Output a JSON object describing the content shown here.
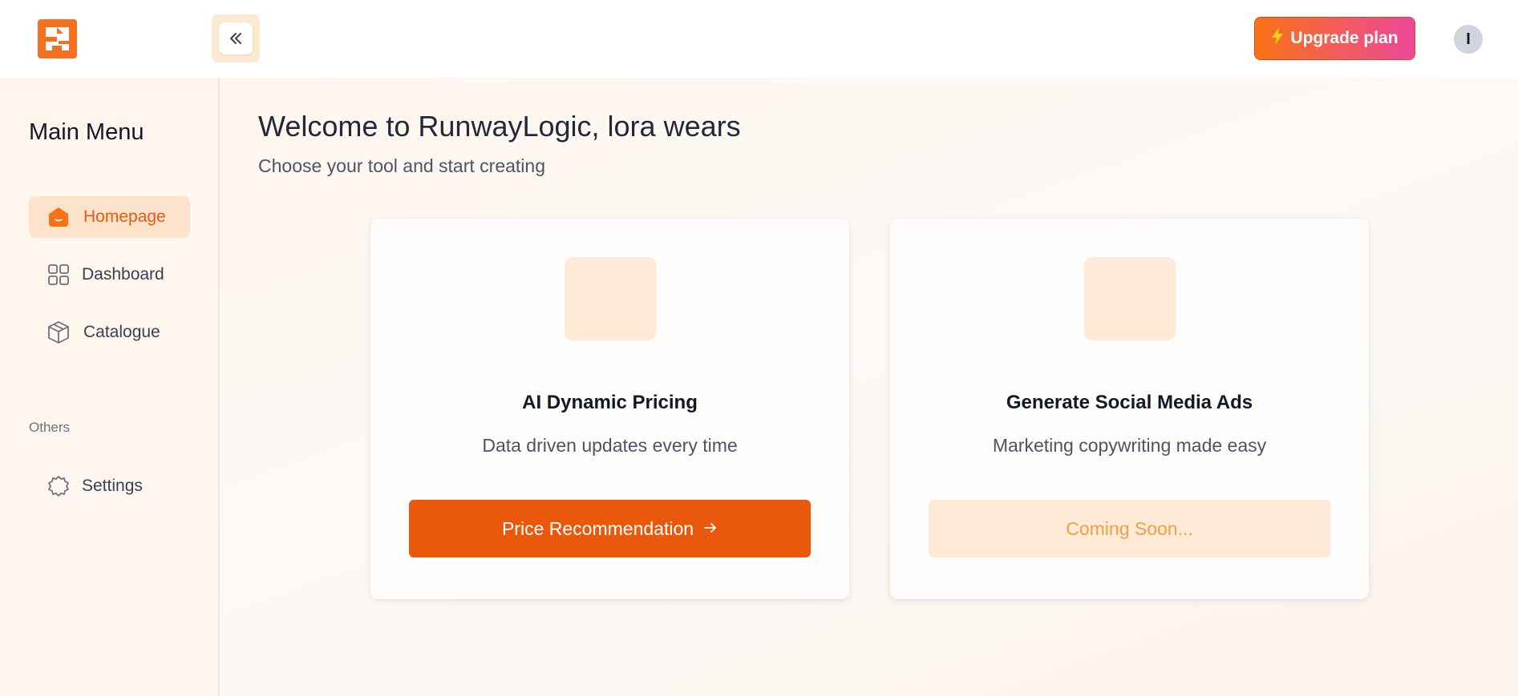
{
  "header": {
    "logo_icon": "brand-logo-icon",
    "collapse_icon": "double-chevron-left-icon",
    "upgrade_label": "Upgrade plan",
    "upgrade_icon": "lightning-icon",
    "avatar_initial": "I"
  },
  "sidebar": {
    "title": "Main Menu",
    "items": [
      {
        "label": "Homepage",
        "icon": "home-icon",
        "active": true
      },
      {
        "label": "Dashboard",
        "icon": "grid-icon",
        "active": false
      },
      {
        "label": "Catalogue",
        "icon": "box-icon",
        "active": false
      }
    ],
    "others_label": "Others",
    "others_items": [
      {
        "label": "Settings",
        "icon": "gear-icon",
        "active": false
      }
    ]
  },
  "main": {
    "welcome": "Welcome to RunwayLogic, lora wears",
    "subtitle": "Choose your tool and start creating",
    "cards": [
      {
        "title": "AI Dynamic Pricing",
        "description": "Data driven updates every time",
        "button_label": "Price Recommendation",
        "button_icon": "arrow-right-icon",
        "enabled": true
      },
      {
        "title": "Generate Social Media Ads",
        "description": "Marketing copywriting made easy",
        "button_label": "Coming Soon...",
        "enabled": false
      }
    ]
  },
  "colors": {
    "accent": "#ea580c",
    "accent_light": "#feead6",
    "upgrade_gradient_start": "#f97316",
    "upgrade_gradient_end": "#ec4899"
  }
}
